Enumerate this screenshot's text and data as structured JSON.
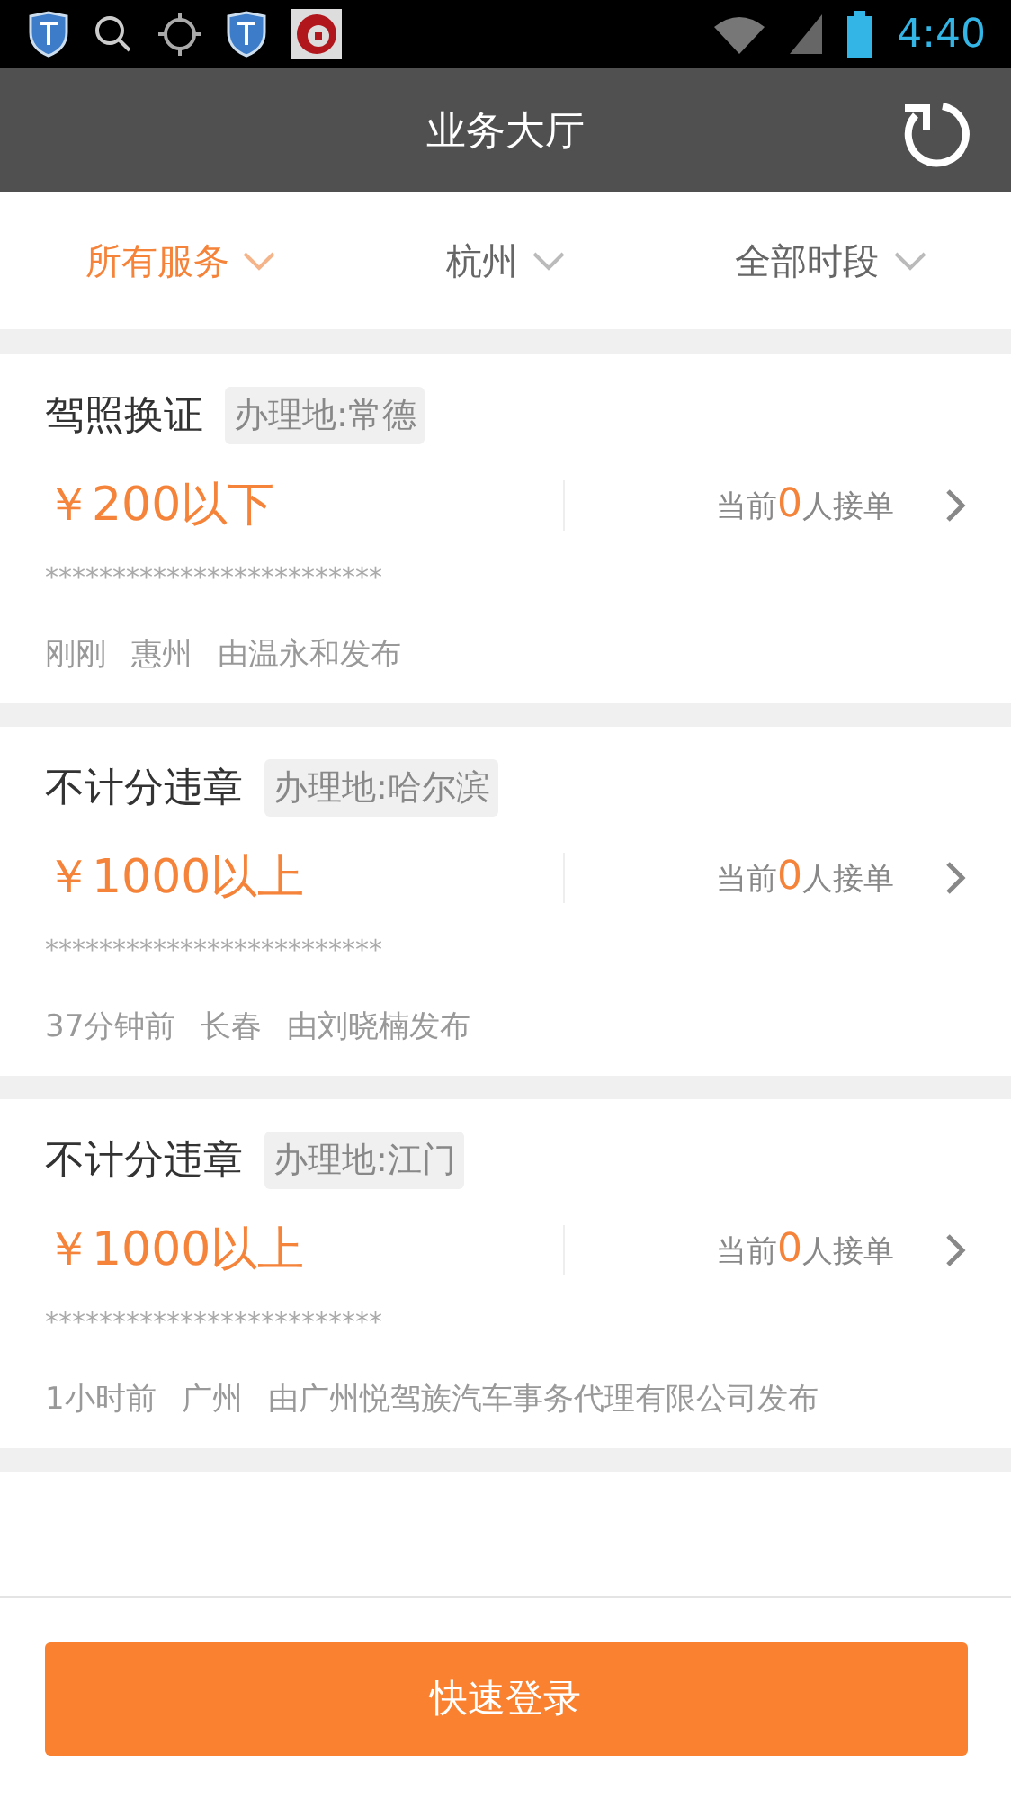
{
  "status_bar": {
    "time": "4:40"
  },
  "header": {
    "title": "业务大厅"
  },
  "filters": [
    {
      "label": "所有服务",
      "selected": true
    },
    {
      "label": "杭州",
      "selected": false
    },
    {
      "label": "全部时段",
      "selected": false
    }
  ],
  "orders": [
    {
      "title": "驾照换证",
      "place": "办理地:常德",
      "price": "￥200以下",
      "count_prefix": "当前",
      "count": "0",
      "count_suffix": "人接单",
      "masked": "*************************",
      "time": "刚刚",
      "city": "惠州",
      "publisher": "由温永和发布"
    },
    {
      "title": "不计分违章",
      "place": "办理地:哈尔滨",
      "price": "￥1000以上",
      "count_prefix": "当前",
      "count": "0",
      "count_suffix": "人接单",
      "masked": "*************************",
      "time": "37分钟前",
      "city": "长春",
      "publisher": "由刘晓楠发布"
    },
    {
      "title": "不计分违章",
      "place": "办理地:江门",
      "price": "￥1000以上",
      "count_prefix": "当前",
      "count": "0",
      "count_suffix": "人接单",
      "masked": "*************************",
      "time": "1小时前",
      "city": "广州",
      "publisher": "由广州悦驾族汽车事务代理有限公司发布"
    }
  ],
  "login_button": "快速登录"
}
